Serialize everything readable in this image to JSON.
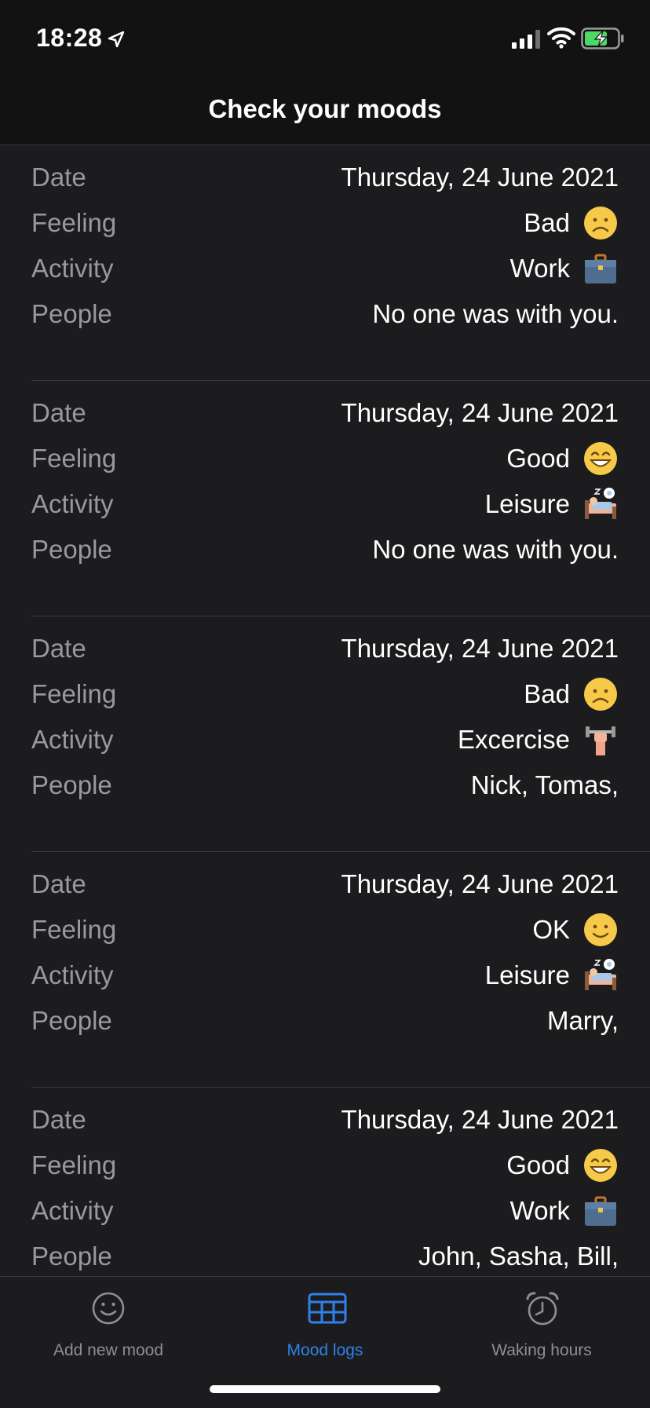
{
  "status_bar": {
    "time": "18:28"
  },
  "header": {
    "title": "Check your moods"
  },
  "labels": {
    "date": "Date",
    "feeling": "Feeling",
    "activity": "Activity",
    "people": "People"
  },
  "entries": [
    {
      "date": "Thursday, 24 June 2021",
      "feeling": "Bad",
      "feeling_icon": "frown-face-icon",
      "activity": "Work",
      "activity_icon": "briefcase-icon",
      "people": "No one was with you."
    },
    {
      "date": "Thursday, 24 June 2021",
      "feeling": "Good",
      "feeling_icon": "grin-face-icon",
      "activity": "Leisure",
      "activity_icon": "bed-icon",
      "people": "No one was with you."
    },
    {
      "date": "Thursday, 24 June 2021",
      "feeling": "Bad",
      "feeling_icon": "frown-face-icon",
      "activity": "Excercise",
      "activity_icon": "dumbbell-icon",
      "people": "Nick, Tomas,"
    },
    {
      "date": "Thursday, 24 June 2021",
      "feeling": "OK",
      "feeling_icon": "smile-face-icon",
      "activity": "Leisure",
      "activity_icon": "bed-icon",
      "people": "Marry,"
    },
    {
      "date": "Thursday, 24 June 2021",
      "feeling": "Good",
      "feeling_icon": "grin-face-icon",
      "activity": "Work",
      "activity_icon": "briefcase-icon",
      "people": "John, Sasha, Bill,"
    }
  ],
  "tabs": [
    {
      "label": "Add new mood",
      "icon": "smiley-icon",
      "active": false
    },
    {
      "label": "Mood logs",
      "icon": "table-icon",
      "active": true
    },
    {
      "label": "Waking hours",
      "icon": "alarm-clock-icon",
      "active": false
    }
  ],
  "colors": {
    "background": "#1c1c1e",
    "accent": "#2f80ed",
    "label": "#98989f",
    "emoji_yellow": "#f7c948"
  }
}
